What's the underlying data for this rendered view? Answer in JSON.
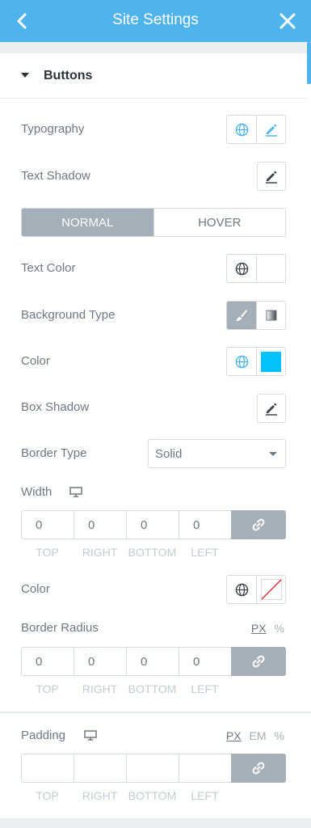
{
  "header": {
    "title": "Site Settings",
    "back_icon": "chevron-left-icon",
    "close_icon": "close-icon",
    "color": "#4fb3ec"
  },
  "section": {
    "title": "Buttons"
  },
  "typography": {
    "label": "Typography"
  },
  "text_shadow": {
    "label": "Text Shadow"
  },
  "state_tabs": {
    "normal": "NORMAL",
    "hover": "HOVER",
    "active": "NORMAL"
  },
  "text_color": {
    "label": "Text Color"
  },
  "background_type": {
    "label": "Background Type",
    "selected": "classic"
  },
  "color": {
    "label": "Color",
    "swatch": "#00c2ff"
  },
  "box_shadow": {
    "label": "Box Shadow"
  },
  "border_type": {
    "label": "Border Type",
    "value": "Solid"
  },
  "width": {
    "label": "Width",
    "values": [
      "0",
      "0",
      "0",
      "0"
    ],
    "sides": [
      "TOP",
      "RIGHT",
      "BOTTOM",
      "LEFT"
    ]
  },
  "border_color": {
    "label": "Color"
  },
  "border_radius": {
    "label": "Border Radius",
    "units": [
      "PX",
      "%"
    ],
    "selected_unit": "PX",
    "values": [
      "0",
      "0",
      "0",
      "0"
    ],
    "sides": [
      "TOP",
      "RIGHT",
      "BOTTOM",
      "LEFT"
    ]
  },
  "padding": {
    "label": "Padding",
    "units": [
      "PX",
      "EM",
      "%"
    ],
    "selected_unit": "PX",
    "values": [
      "",
      "",
      "",
      ""
    ],
    "sides": [
      "TOP",
      "RIGHT",
      "BOTTOM",
      "LEFT"
    ]
  }
}
